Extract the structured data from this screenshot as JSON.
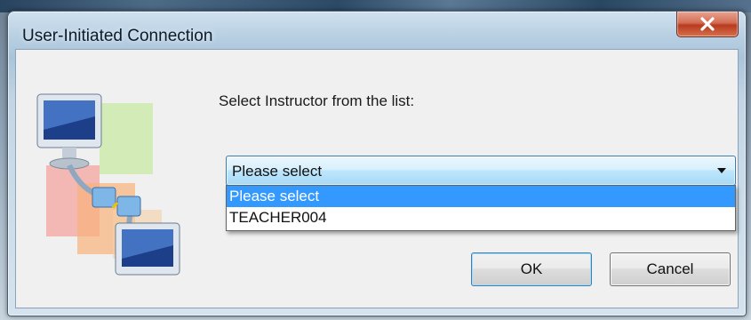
{
  "window": {
    "title": "User-Initiated Connection",
    "close_icon": "close-icon"
  },
  "dialog": {
    "prompt": "Select Instructor from the list:",
    "instructor_select": {
      "value": "Please select",
      "options": [
        "Please select",
        "TEACHER004"
      ],
      "highlighted_index": 0
    },
    "ok_label": "OK",
    "cancel_label": "Cancel",
    "illustration_icon": "network-connection-icon"
  },
  "colors": {
    "selection": "#3399ff",
    "close_button": "#c94a2b"
  }
}
